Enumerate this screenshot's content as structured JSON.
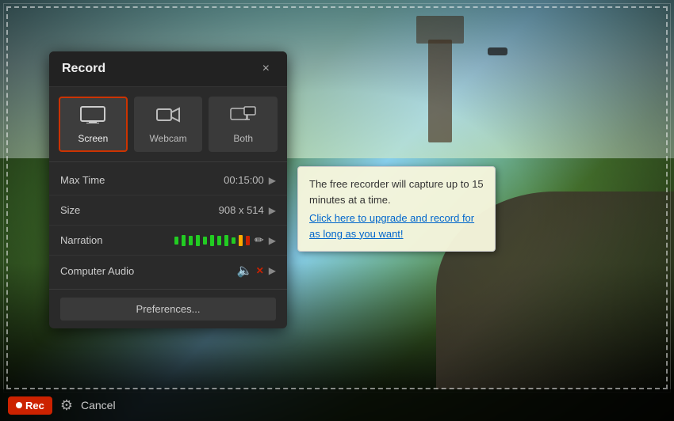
{
  "panel": {
    "title": "Record",
    "close_label": "×",
    "modes": [
      {
        "id": "screen",
        "label": "Screen",
        "active": true
      },
      {
        "id": "webcam",
        "label": "Webcam",
        "active": false
      },
      {
        "id": "both",
        "label": "Both",
        "active": false
      }
    ],
    "settings": [
      {
        "label": "Max Time",
        "value": "00:15:00",
        "has_arrow": true
      },
      {
        "label": "Size",
        "value": "908 x 514",
        "has_arrow": true
      },
      {
        "label": "Narration",
        "value": "",
        "has_arrow": true
      },
      {
        "label": "Computer Audio",
        "value": "",
        "has_arrow": true
      }
    ],
    "preferences_label": "Preferences..."
  },
  "tooltip": {
    "text": "The free recorder will capture up to 15 minutes at a time.",
    "link_text": "Click here to upgrade and record for as long as you want!"
  },
  "bottom_bar": {
    "rec_label": "Rec",
    "cancel_label": "Cancel"
  },
  "narration_bars": [
    {
      "color": "#22cc22",
      "height": 14
    },
    {
      "color": "#22cc22",
      "height": 14
    },
    {
      "color": "#22cc22",
      "height": 12
    },
    {
      "color": "#22cc22",
      "height": 14
    },
    {
      "color": "#22cc22",
      "height": 10
    },
    {
      "color": "#22cc22",
      "height": 14
    },
    {
      "color": "#22cc22",
      "height": 12
    },
    {
      "color": "#22cc22",
      "height": 14
    },
    {
      "color": "#22cc22",
      "height": 8
    },
    {
      "color": "#ffaa00",
      "height": 14
    },
    {
      "color": "#cc2200",
      "height": 12
    }
  ]
}
